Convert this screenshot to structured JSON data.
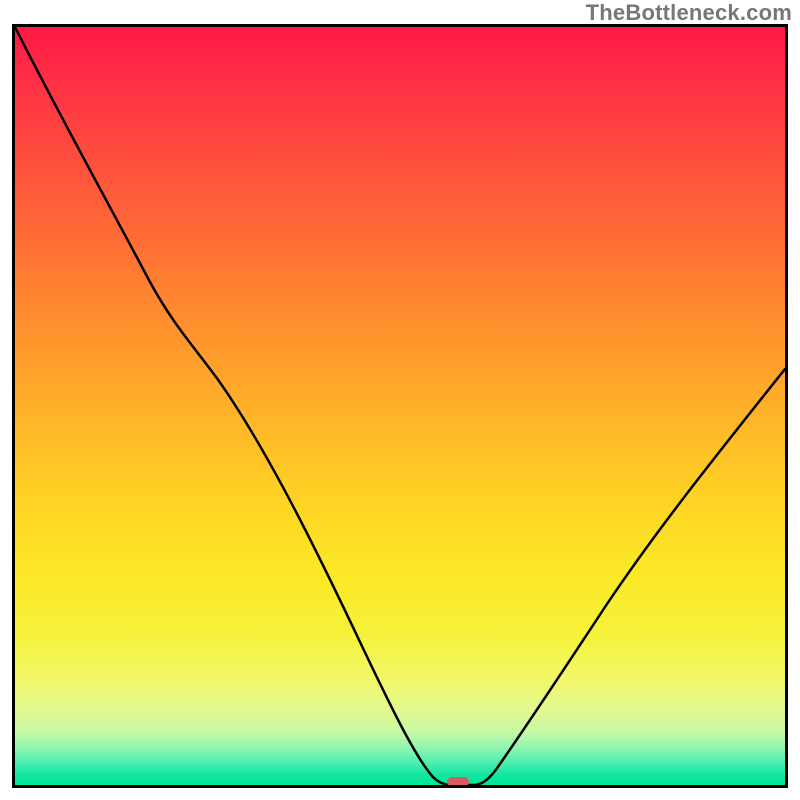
{
  "watermark": "TheBottleneck.com",
  "chart_data": {
    "type": "line",
    "title": "",
    "xlabel": "",
    "ylabel": "",
    "x_range": [
      0,
      100
    ],
    "y_range": [
      0,
      100
    ],
    "series": [
      {
        "name": "curve",
        "x": [
          0,
          7,
          14,
          21,
          26,
          31,
          36,
          41,
          46,
          49,
          52,
          55,
          56,
          58,
          60,
          62,
          66,
          72,
          79,
          86,
          93,
          100
        ],
        "values": [
          100,
          88,
          76,
          64,
          56,
          47,
          38,
          28,
          18,
          11,
          5,
          1,
          0,
          0,
          1,
          3,
          8,
          17,
          27,
          37,
          46,
          55
        ]
      }
    ],
    "marker": {
      "x": 57,
      "y": 0,
      "color": "#d85a63",
      "radius": 1.2
    },
    "background": "red-yellow-green vertical gradient"
  }
}
